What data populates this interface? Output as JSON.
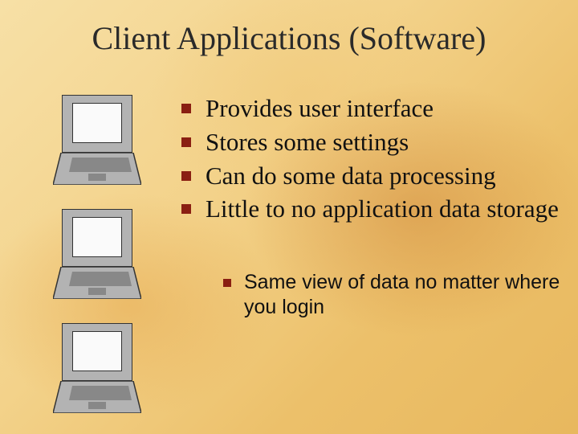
{
  "title": "Client Applications (Software)",
  "bullets": {
    "b0": "Provides user interface",
    "b1": "Stores some settings",
    "b2": "Can do some data processing",
    "b3": "Little to no application data storage"
  },
  "sub": {
    "s0": "Same view of data no matter where you login"
  },
  "colors": {
    "bullet": "#8a1f12"
  }
}
